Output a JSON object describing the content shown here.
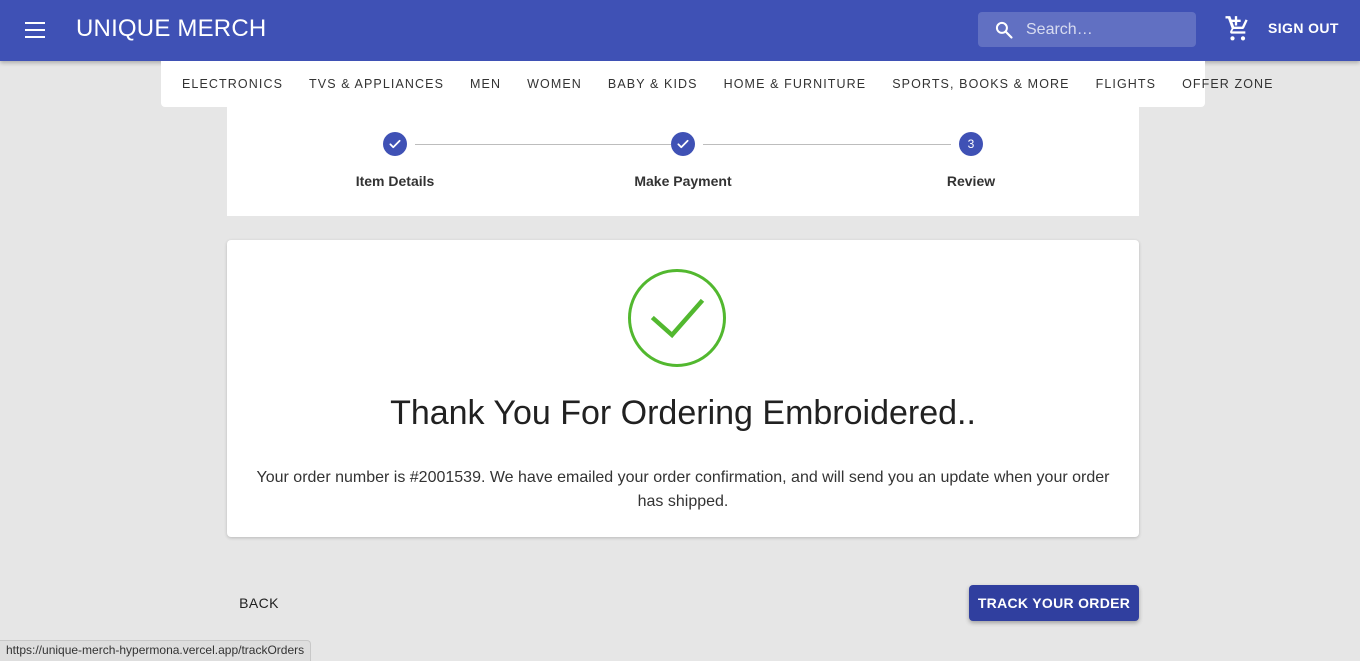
{
  "header": {
    "brand": "UNIQUE MERCH",
    "search_placeholder": "Search…",
    "sign_out_label": "SIGN OUT"
  },
  "categories": [
    "ELECTRONICS",
    "TVS & APPLIANCES",
    "MEN",
    "WOMEN",
    "BABY & KIDS",
    "HOME & FURNITURE",
    "SPORTS, BOOKS & MORE",
    "FLIGHTS",
    "OFFER ZONE"
  ],
  "stepper": {
    "steps": [
      {
        "label": "Item Details",
        "status": "completed"
      },
      {
        "label": "Make Payment",
        "status": "completed"
      },
      {
        "label": "Review",
        "status": "active",
        "number": "3"
      }
    ]
  },
  "confirmation": {
    "title": "Thank You For Ordering Embroidered..",
    "message": "Your order number is #2001539. We have emailed your order confirmation, and will send you an update when your order has shipped."
  },
  "actions": {
    "back_label": "BACK",
    "track_label": "TRACK YOUR ORDER"
  },
  "status_bar": {
    "url": "https://unique-merch-hypermona.vercel.app/trackOrders"
  },
  "colors": {
    "primary": "#3f51b5",
    "primary_dark": "#303f9f",
    "success": "#4caf50",
    "background": "#e6e6e6"
  }
}
